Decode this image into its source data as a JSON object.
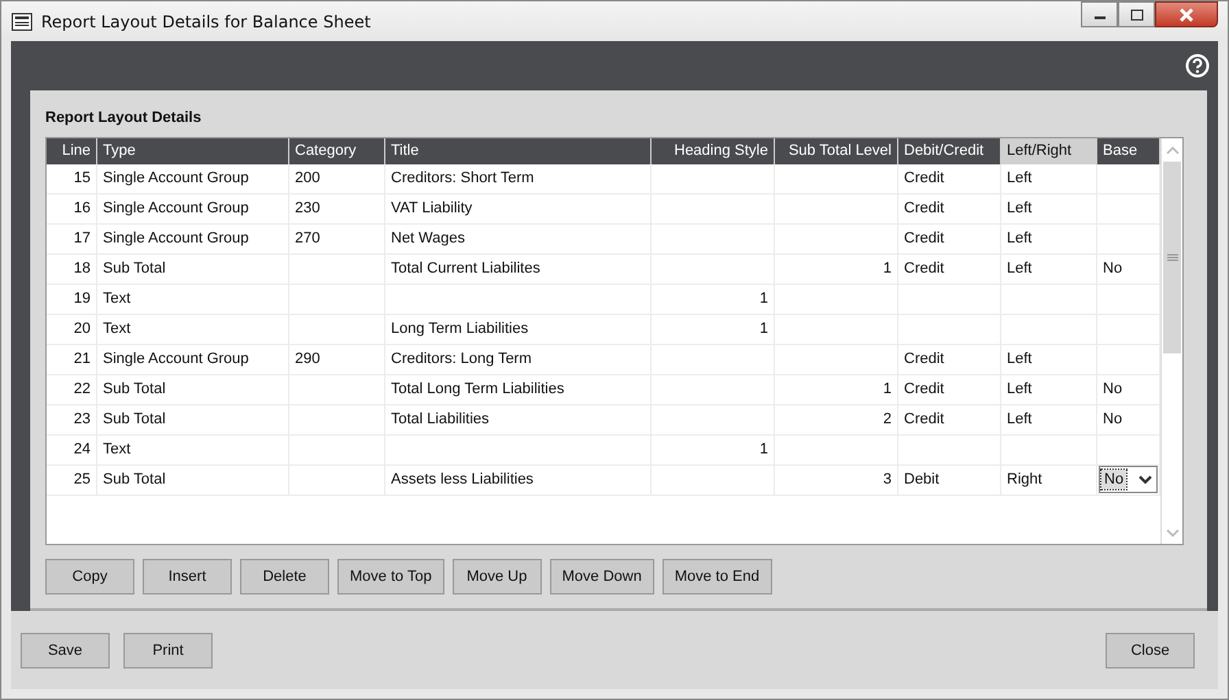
{
  "window": {
    "title": "Report Layout Details for Balance Sheet"
  },
  "section_title": "Report Layout Details",
  "table": {
    "columns": [
      {
        "label": "Line",
        "selected": false
      },
      {
        "label": "Type",
        "selected": false
      },
      {
        "label": "Category",
        "selected": false
      },
      {
        "label": "Title",
        "selected": false
      },
      {
        "label": "Heading Style",
        "selected": false
      },
      {
        "label": "Sub Total Level",
        "selected": false
      },
      {
        "label": "Debit/Credit",
        "selected": false
      },
      {
        "label": "Left/Right",
        "selected": true
      },
      {
        "label": "Base",
        "selected": false
      }
    ],
    "rows": [
      {
        "cells": [
          "15",
          "Single Account Group",
          "200",
          "Creditors: Short Term",
          "",
          "",
          "Credit",
          "Left",
          ""
        ],
        "editing": false
      },
      {
        "cells": [
          "16",
          "Single Account Group",
          "230",
          "VAT Liability",
          "",
          "",
          "Credit",
          "Left",
          ""
        ],
        "editing": false
      },
      {
        "cells": [
          "17",
          "Single Account Group",
          "270",
          "Net Wages",
          "",
          "",
          "Credit",
          "Left",
          ""
        ],
        "editing": false
      },
      {
        "cells": [
          "18",
          "Sub Total",
          "",
          "Total Current Liabilites",
          "",
          "1",
          "Credit",
          "Left",
          "No"
        ],
        "editing": false
      },
      {
        "cells": [
          "19",
          "Text",
          "",
          "",
          "1",
          "",
          "",
          "",
          ""
        ],
        "editing": false
      },
      {
        "cells": [
          "20",
          "Text",
          "",
          "Long Term Liabilities",
          "1",
          "",
          "",
          "",
          ""
        ],
        "editing": false
      },
      {
        "cells": [
          "21",
          "Single Account Group",
          "290",
          "Creditors: Long Term",
          "",
          "",
          "Credit",
          "Left",
          ""
        ],
        "editing": false
      },
      {
        "cells": [
          "22",
          "Sub Total",
          "",
          "Total Long Term Liabilities",
          "",
          "1",
          "Credit",
          "Left",
          "No"
        ],
        "editing": false
      },
      {
        "cells": [
          "23",
          "Sub Total",
          "",
          "Total Liabilities",
          "",
          "2",
          "Credit",
          "Left",
          "No"
        ],
        "editing": false
      },
      {
        "cells": [
          "24",
          "Text",
          "",
          "",
          "1",
          "",
          "",
          "",
          ""
        ],
        "editing": false
      },
      {
        "cells": [
          "25",
          "Sub Total",
          "",
          "Assets less Liabilities",
          "",
          "3",
          "Debit",
          "Right",
          "No"
        ],
        "editing": true
      }
    ]
  },
  "row_buttons": [
    "Copy",
    "Insert",
    "Delete",
    "Move to Top",
    "Move Up",
    "Move Down",
    "Move to End"
  ],
  "footer_buttons": [
    "Save",
    "Print"
  ],
  "close_button": "Close"
}
